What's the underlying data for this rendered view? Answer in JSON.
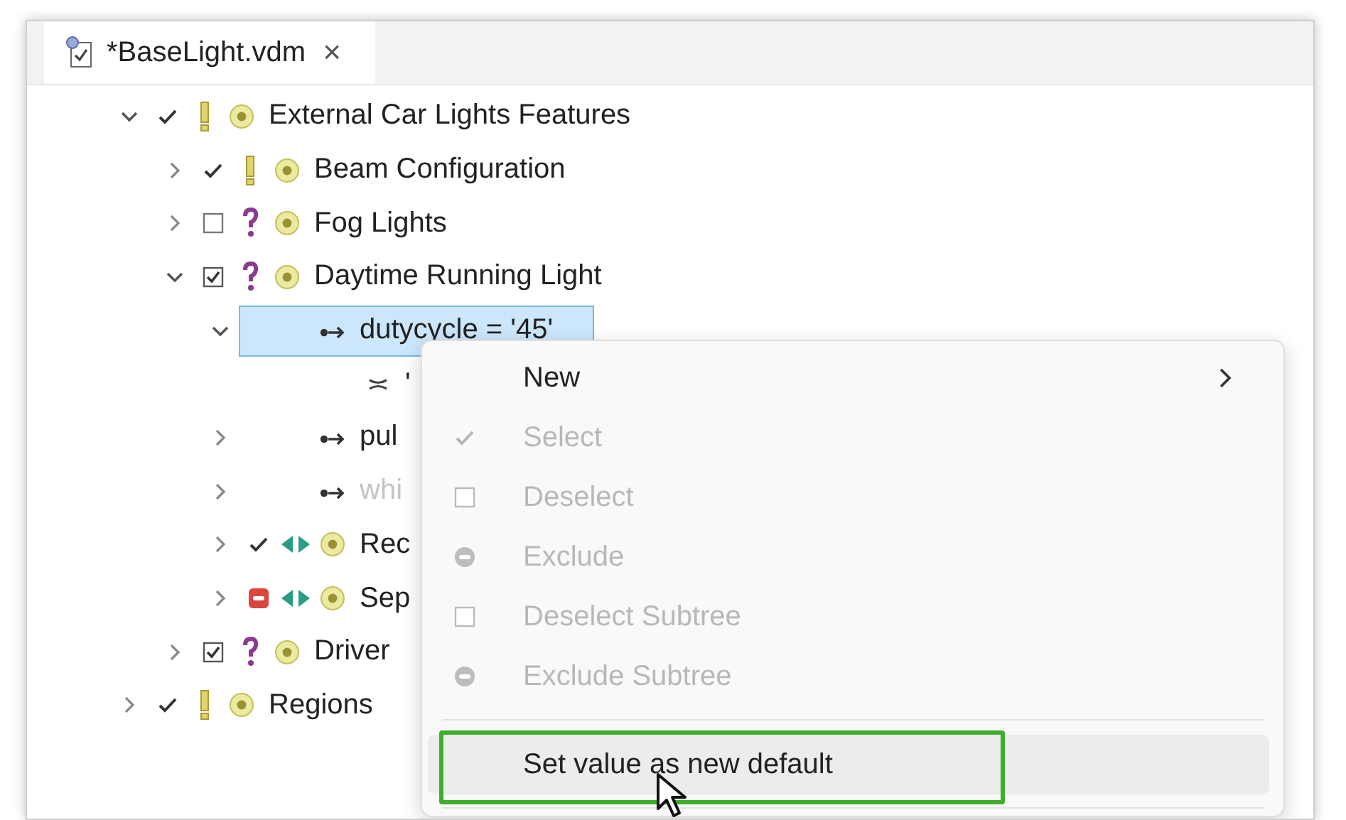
{
  "tab": {
    "title": "*BaseLight.vdm",
    "close": "×",
    "selected": true
  },
  "tree": [
    {
      "label": "External Car Lights Features",
      "kind": "feature",
      "implied": true,
      "checked": true,
      "excluded": false,
      "optional": false,
      "alternative": false,
      "expanded": true,
      "selected": false,
      "disabled": false,
      "children": [
        {
          "label": "Beam Configuration",
          "kind": "feature",
          "implied": true,
          "checked": true,
          "excluded": false,
          "optional": false,
          "alternative": false,
          "expanded": false,
          "selected": false,
          "disabled": false
        },
        {
          "label": "Fog Lights",
          "kind": "feature",
          "implied": false,
          "checked": false,
          "excluded": false,
          "optional": true,
          "alternative": false,
          "expanded": false,
          "selected": false,
          "disabled": false
        },
        {
          "label": "Daytime Running Light",
          "kind": "feature",
          "implied": false,
          "checked": true,
          "excluded": false,
          "optional": true,
          "alternative": false,
          "expanded": true,
          "selected": false,
          "disabled": false,
          "children": [
            {
              "label": "dutycycle = '45'",
              "kind": "attribute",
              "expanded": true,
              "selected": true,
              "disabled": false,
              "children": [
                {
                  "label": "'",
                  "kind": "value",
                  "selected": false,
                  "disabled": false
                }
              ]
            },
            {
              "label": "pul",
              "kind": "attribute",
              "expanded": false,
              "selected": false,
              "disabled": false
            },
            {
              "label": "whi",
              "kind": "attribute",
              "expanded": false,
              "selected": false,
              "disabled": true
            },
            {
              "label": "Rec",
              "kind": "feature",
              "implied": true,
              "checked": true,
              "excluded": false,
              "alternative": true,
              "expanded": false,
              "selected": false,
              "disabled": false
            },
            {
              "label": "Sep",
              "kind": "feature",
              "excluded": true,
              "alternative": true,
              "expanded": false,
              "selected": false,
              "disabled": false
            }
          ]
        },
        {
          "label": "Driver",
          "kind": "feature",
          "implied": false,
          "checked": true,
          "excluded": false,
          "optional": true,
          "alternative": false,
          "expanded": false,
          "selected": false,
          "disabled": false
        }
      ]
    },
    {
      "label": "Regions",
      "kind": "feature",
      "implied": true,
      "checked": true,
      "excluded": false,
      "optional": false,
      "alternative": false,
      "expanded": false,
      "selected": false,
      "disabled": false
    }
  ],
  "context_menu": {
    "items": [
      {
        "kind": "submenu",
        "label": "New",
        "disabled": false,
        "hovered": false,
        "outlined": false
      },
      {
        "kind": "select",
        "label": "Select",
        "disabled": true,
        "hovered": false,
        "outlined": false
      },
      {
        "kind": "deselect",
        "label": "Deselect",
        "disabled": true,
        "hovered": false,
        "outlined": false
      },
      {
        "kind": "exclude",
        "label": "Exclude",
        "disabled": true,
        "hovered": false,
        "outlined": false
      },
      {
        "kind": "deselect",
        "label": "Deselect Subtree",
        "disabled": true,
        "hovered": false,
        "outlined": false
      },
      {
        "kind": "exclude",
        "label": "Exclude Subtree",
        "disabled": true,
        "hovered": false,
        "outlined": false
      },
      {
        "kind": "separator"
      },
      {
        "kind": "command",
        "label": "Set value as new default",
        "disabled": false,
        "hovered": true,
        "outlined": true
      },
      {
        "kind": "separator"
      }
    ]
  }
}
